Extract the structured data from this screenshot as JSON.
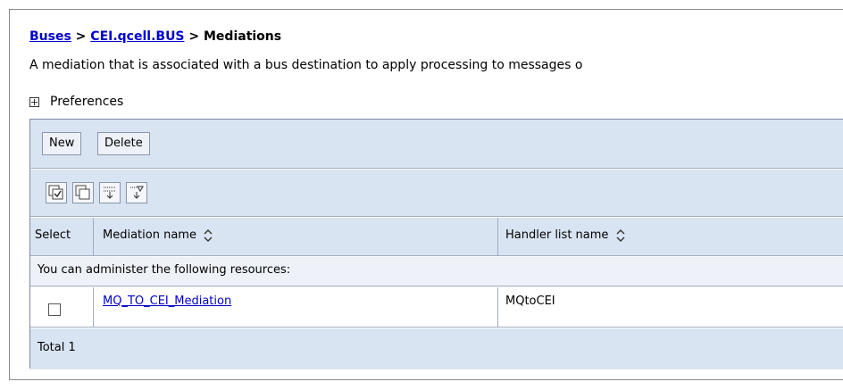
{
  "breadcrumb": {
    "link1": "Buses",
    "sep1": " > ",
    "link2": "CEI.qcell.BUS",
    "sep2": " > ",
    "current": "Mediations"
  },
  "description": "A mediation that is associated with a bus destination to apply processing to messages o",
  "preferences_label": "Preferences",
  "toolbar": {
    "new_label": "New",
    "delete_label": "Delete",
    "icons": [
      "select-all-icon",
      "deselect-all-icon",
      "show-filter-icon",
      "clear-filter-icon"
    ]
  },
  "table": {
    "columns": [
      "Select",
      "Mediation name",
      "Handler list name"
    ],
    "info_message": "You can administer the following resources:",
    "rows": [
      {
        "selected": false,
        "mediation_name": "MQ_TO_CEI_Mediation",
        "handler_list_name": "MQtoCEI"
      }
    ],
    "total_label": "Total 1"
  },
  "colors": {
    "link": "#0000cc",
    "header_bg": "#d9e4f2",
    "info_bg": "#eef2f8"
  }
}
